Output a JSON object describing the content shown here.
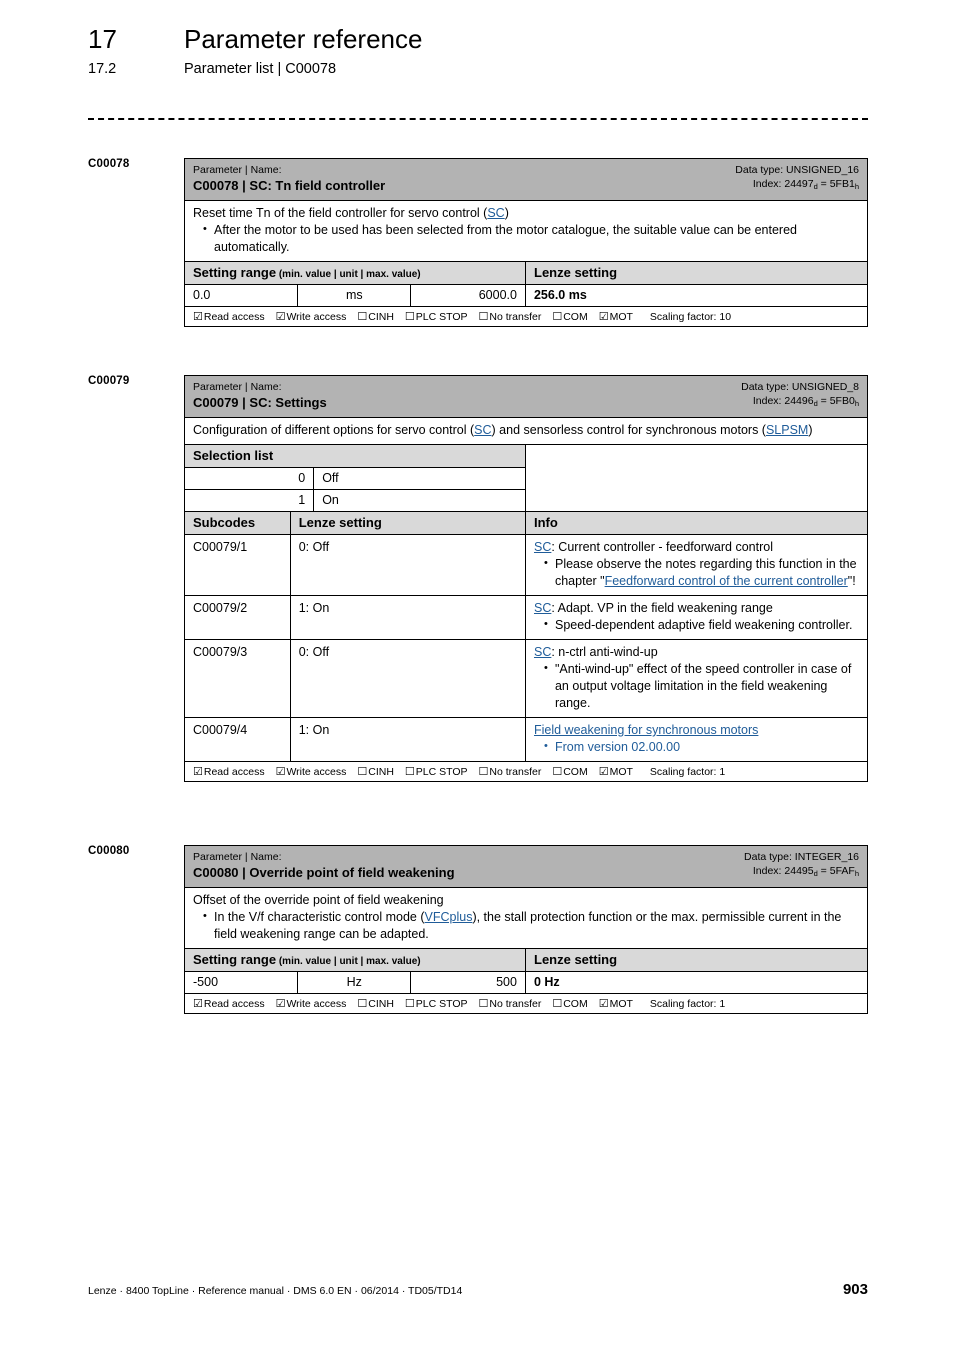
{
  "header": {
    "chapter_number": "17",
    "chapter_title": "Parameter reference",
    "section_number": "17.2",
    "section_title": "Parameter list | C00078"
  },
  "colors": {
    "table_header_gray": "#b3b3b3",
    "subheader_gray": "#d9d9d9",
    "link_blue": "#1f5c99",
    "border": "#000000"
  },
  "access_labels": {
    "read": "Read access",
    "write": "Write access",
    "cinh": "CINH",
    "plc_stop": "PLC STOP",
    "no_transfer": "No transfer",
    "com": "COM",
    "mot": "MOT",
    "checked_glyph": "☑",
    "unchecked_glyph": "☐"
  },
  "blocks": [
    {
      "label": "C00078",
      "head": {
        "kicker": "Parameter | Name:",
        "name": "C00078 | SC: Tn field controller",
        "data_type": "Data type: UNSIGNED_16",
        "index_prefix": "Index: 24497",
        "index_sub_dec": "d",
        "index_mid": " = 5FB1",
        "index_sub_hex": "h"
      },
      "description": {
        "lead_pre": "Reset time Tn of the field controller for servo control (",
        "lead_link": "SC",
        "lead_post": ")",
        "bullets": [
          "After the motor to be used has been selected from the motor catalogue, the suitable value can be entered automatically."
        ]
      },
      "setting_range": {
        "header_bold": "Setting range",
        "header_note": " (min. value | unit | max. value)",
        "lenze_header": "Lenze setting",
        "min": "0.0",
        "unit": "ms",
        "max": "6000.0",
        "lenze_value": "256.0 ms"
      },
      "access": {
        "read": true,
        "write": true,
        "cinh": false,
        "plc_stop": false,
        "no_transfer": false,
        "com": false,
        "mot": true,
        "scaling": "Scaling factor: 10"
      }
    },
    {
      "label": "C00079",
      "head": {
        "kicker": "Parameter | Name:",
        "name": "C00079 | SC: Settings",
        "data_type": "Data type: UNSIGNED_8",
        "index_prefix": "Index: 24496",
        "index_sub_dec": "d",
        "index_mid": " = 5FB0",
        "index_sub_hex": "h"
      },
      "description": {
        "lead_pre": "Configuration of different options for servo control (",
        "lead_link": "SC",
        "lead_mid": ") and sensorless control for synchronous motors (",
        "lead_link2": "SLPSM",
        "lead_post": ")"
      },
      "selection_list": {
        "header": "Selection list",
        "options": [
          {
            "code": "0",
            "text": "Off"
          },
          {
            "code": "1",
            "text": "On"
          }
        ]
      },
      "subcodes_table": {
        "headers": [
          "Subcodes",
          "Lenze setting",
          "Info"
        ],
        "rows": [
          {
            "subcode": "C00079/1",
            "lenze": "0: Off",
            "info_link": "SC",
            "info_lead": ": Current controller - feedforward control",
            "bullet_pre": "Please observe the notes regarding this function in the chapter \"",
            "bullet_link": "Feedforward control of the current controller",
            "bullet_post": "\"!"
          },
          {
            "subcode": "C00079/2",
            "lenze": "1: On",
            "info_link": "SC",
            "info_lead": ": Adapt. VP in the field weakening range",
            "bullet_plain": "Speed-dependent adaptive field weakening controller."
          },
          {
            "subcode": "C00079/3",
            "lenze": "0: Off",
            "info_link": "SC",
            "info_lead": ": n-ctrl anti-wind-up",
            "bullet_plain": "\"Anti-wind-up\" effect of the speed controller in case of an output voltage limitation in the field weakening range."
          },
          {
            "subcode": "C00079/4",
            "lenze": "1: On",
            "info_heading_link": "Field weakening for synchronous motors",
            "bullet_blue": "From version 02.00.00"
          }
        ]
      },
      "access": {
        "read": true,
        "write": true,
        "cinh": false,
        "plc_stop": false,
        "no_transfer": false,
        "com": false,
        "mot": true,
        "scaling": "Scaling factor: 1"
      }
    },
    {
      "label": "C00080",
      "head": {
        "kicker": "Parameter | Name:",
        "name": "C00080 | Override point of field weakening",
        "data_type": "Data type: INTEGER_16",
        "index_prefix": "Index: 24495",
        "index_sub_dec": "d",
        "index_mid": " = 5FAF",
        "index_sub_hex": "h"
      },
      "description": {
        "lead": "Offset of the override point of field weakening",
        "bullet_pre": "In the V/f characteristic control mode (",
        "bullet_link": "VFCplus",
        "bullet_post": "), the stall protection function or the max. permissible current in the field weakening range can be adapted."
      },
      "setting_range": {
        "header_bold": "Setting range",
        "header_note": " (min. value | unit | max. value)",
        "lenze_header": "Lenze setting",
        "min": "-500",
        "unit": "Hz",
        "max": "500",
        "lenze_value": "0 Hz"
      },
      "access": {
        "read": true,
        "write": true,
        "cinh": false,
        "plc_stop": false,
        "no_transfer": false,
        "com": false,
        "mot": true,
        "scaling": "Scaling factor: 1"
      }
    }
  ],
  "footer": {
    "text": "Lenze · 8400 TopLine · Reference manual · DMS 6.0 EN · 06/2014 · TD05/TD14",
    "page_number": "903"
  }
}
